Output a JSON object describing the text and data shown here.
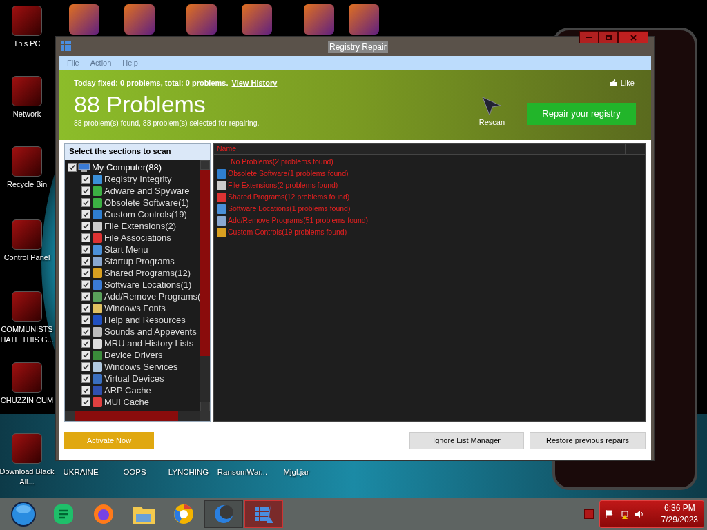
{
  "desktop_icons": [
    {
      "label": "This PC"
    },
    {
      "label": "Network"
    },
    {
      "label": "Recycle Bin"
    },
    {
      "label": "Control Panel"
    },
    {
      "label": "COMMUNISTS HATE THIS G..."
    },
    {
      "label": "CHUZZIN CUM"
    },
    {
      "label": "Download Black Ali..."
    }
  ],
  "bottom_icons": [
    {
      "label": "UKRAINE"
    },
    {
      "label": "OOPS"
    },
    {
      "label": "LYNCHING"
    },
    {
      "label": "RansomWar..."
    },
    {
      "label": "Mjgl.jar"
    }
  ],
  "window": {
    "title": "Registry Repair",
    "menu": [
      {
        "label": "File",
        "disabled": true
      },
      {
        "label": "Action",
        "disabled": true
      },
      {
        "label": "Help",
        "disabled": true
      }
    ],
    "header": {
      "summary": "Today fixed: 0 problems, total: 0 problems.",
      "history_link": "View History",
      "like": "Like",
      "headline": "88 Problems",
      "detail": "88 problem(s) found, 88 problem(s) selected for repairing.",
      "rescan": "Rescan",
      "repair_button": "Repair your registry"
    },
    "sections": {
      "title": "Select the sections to scan",
      "tree": {
        "label": "My Computer(88)",
        "checked": true,
        "children": [
          {
            "label": "Registry Integrity",
            "checked": true
          },
          {
            "label": "Adware and Spyware",
            "checked": true
          },
          {
            "label": "Obsolete Software(1)",
            "checked": true
          },
          {
            "label": "Custom Controls(19)",
            "checked": true
          },
          {
            "label": "File Extensions(2)",
            "checked": true
          },
          {
            "label": "File Associations",
            "checked": true
          },
          {
            "label": "Start Menu",
            "checked": true
          },
          {
            "label": "Startup Programs",
            "checked": true
          },
          {
            "label": "Shared Programs(12)",
            "checked": true
          },
          {
            "label": "Software Locations(1)",
            "checked": true
          },
          {
            "label": "Add/Remove Programs(",
            "checked": true
          },
          {
            "label": "Windows Fonts",
            "checked": true
          },
          {
            "label": "Help and Resources",
            "checked": true
          },
          {
            "label": "Sounds and Appevents",
            "checked": true
          },
          {
            "label": "MRU and History Lists",
            "checked": true
          },
          {
            "label": "Device Drivers",
            "checked": true
          },
          {
            "label": "Windows Services",
            "checked": true
          },
          {
            "label": "Virtual Devices",
            "checked": true
          },
          {
            "label": "ARP Cache",
            "checked": true
          },
          {
            "label": "MUI Cache",
            "checked": true
          }
        ]
      }
    },
    "results": {
      "column": "Name",
      "rows": [
        {
          "label": "No Problems(2 problems found)",
          "icon": false
        },
        {
          "label": "Obsolete Software(1 problems found)",
          "icon": true
        },
        {
          "label": "File Extensions(2 problems found)",
          "icon": true
        },
        {
          "label": "Shared Programs(12 problems found)",
          "icon": true
        },
        {
          "label": "Software Locations(1 problems found)",
          "icon": true
        },
        {
          "label": "Add/Remove Programs(51 problems found)",
          "icon": true
        },
        {
          "label": "Custom Controls(19 problems found)",
          "icon": true
        }
      ]
    },
    "footer": {
      "activate": "Activate Now",
      "ignore": "Ignore List Manager",
      "restore": "Restore previous repairs"
    }
  },
  "taskbar": {
    "apps": [
      {
        "kind": "start",
        "selected": false
      },
      {
        "kind": "chat",
        "selected": false
      },
      {
        "kind": "browser",
        "selected": false
      },
      {
        "kind": "folder",
        "selected": false
      },
      {
        "kind": "browser2",
        "selected": false
      },
      {
        "kind": "moon",
        "selected": false
      },
      {
        "kind": "registry",
        "selected": true
      }
    ],
    "time": "6:36 PM",
    "date": "7/29/2023"
  }
}
